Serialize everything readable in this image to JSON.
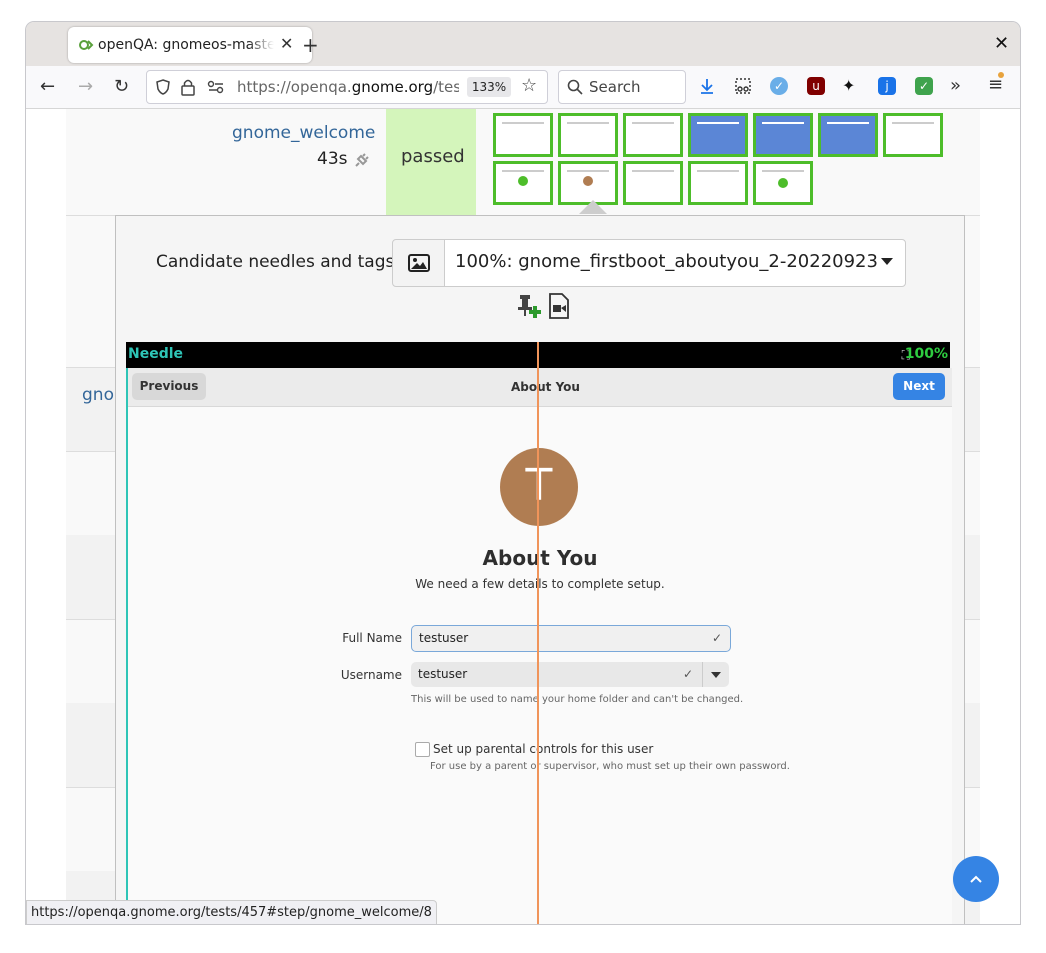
{
  "browser": {
    "tab_title": "openQA: gnomeos-maste",
    "url_prefix": "https://openqa.",
    "url_domain": "gnome.org",
    "url_suffix": "/tests/",
    "zoom": "133%",
    "search_placeholder": "Search",
    "status_url": "https://openqa.gnome.org/tests/457#step/gnome_welcome/8"
  },
  "result_row": {
    "test_name": "gnome_welcome",
    "duration": "43s",
    "result": "passed",
    "next_test_partial": "gno"
  },
  "needle_panel": {
    "candidate_label": "Candidate needles and tags:",
    "selected_candidate": "100%: gnome_firstboot_aboutyou_2-20220923",
    "needle_label": "Needle",
    "needle_match": "100%"
  },
  "gnome_screen": {
    "previous": "Previous",
    "header_title": "About You",
    "next": "Next",
    "avatar_letter": "T",
    "title": "About You",
    "subtitle": "We need a few details to complete setup.",
    "full_name_label": "Full Name",
    "full_name_value": "testuser",
    "username_label": "Username",
    "username_value": "testuser",
    "username_hint": "This will be used to name your home folder and can't be changed.",
    "parental_label": "Set up parental controls for this user",
    "parental_hint": "For use by a parent or supervisor, who must set up their own password."
  },
  "colors": {
    "accent": "#3584e4",
    "passed_bg": "#d4f5bb",
    "thumb_border": "#4dbd2a",
    "needle_line": "#f0945a",
    "needle_label": "#2ec5b7"
  }
}
